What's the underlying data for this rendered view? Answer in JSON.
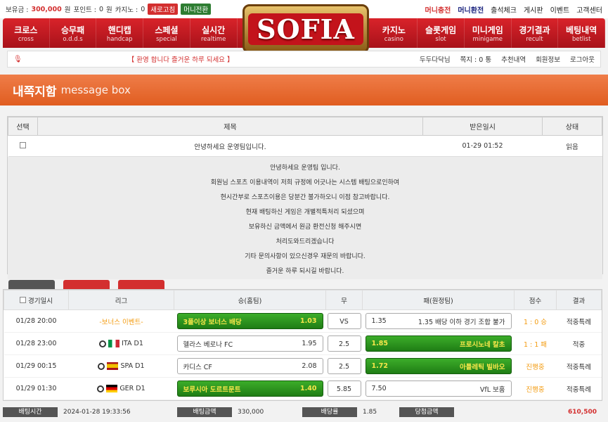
{
  "top": {
    "balance_label": "보유금 : ",
    "balance": "300,000",
    "won": "원",
    "point_label": "포인트 : ",
    "point": "0",
    "point_unit": "원",
    "casino_label": "카지노 : ",
    "casino": "0",
    "refresh": "새로고침",
    "money_convert": "머니전환",
    "links": [
      "머니충전",
      "머니환전",
      "출석체크",
      "게시판",
      "이벤트",
      "고객센터"
    ]
  },
  "nav": {
    "left": [
      {
        "ko": "크로스",
        "en": "cross"
      },
      {
        "ko": "승무패",
        "en": "o.d.d.s"
      },
      {
        "ko": "핸디캡",
        "en": "handcap"
      },
      {
        "ko": "스페셜",
        "en": "special"
      },
      {
        "ko": "실시간",
        "en": "realtime"
      }
    ],
    "right": [
      {
        "ko": "카지노",
        "en": "casino"
      },
      {
        "ko": "슬롯게임",
        "en": "slot"
      },
      {
        "ko": "미니게임",
        "en": "minigame"
      },
      {
        "ko": "경기결과",
        "en": "recult"
      },
      {
        "ko": "베팅내역",
        "en": "betlist"
      }
    ]
  },
  "logo": "SOFIA",
  "bar": {
    "welcome": "【 환영 합니다 즐거운 하루 되세요 】",
    "user": "두두다닥님",
    "notes": "쪽지 : 0 통",
    "recommend": "추천내역",
    "member": "회원정보",
    "logout": "로그아웃"
  },
  "page": {
    "title": "내쪽지함",
    "subtitle": "message box"
  },
  "msg_table": {
    "cols": [
      "선택",
      "제목",
      "받은일시",
      "상태"
    ],
    "row": {
      "title": "안녕하세요 운영팀입니다.",
      "date": "01-29 01:52",
      "status": "읽음"
    }
  },
  "message_lines": [
    "안녕하세요 운영팀 입니다.",
    "회원님 스포츠 이용내역이 저희 규정에 어긋나는 시스템 배팅으로인하여",
    "현시간부로 스포츠이용은 당분간 불가하오니 이점 참고바랍니다.",
    "현재 배팅하신 게임은 개별적특처리 되셨으며",
    "보유하신 금액에서 원금 환전신청 해주시면",
    "처리도와드리겠습니다",
    "기타 문의사항이 있으신경우 재문의 바랍니다.",
    "즐거운 하루 되시길 바랍니다."
  ],
  "bet_table": {
    "cols": [
      "경기일시",
      "리그",
      "승(홈팀)",
      "무",
      "패(원정팀)",
      "점수",
      "결과"
    ],
    "rows": [
      {
        "date": "01/28 20:00",
        "league": "-보너스 이벤트-",
        "home": "3폴이상 보너스 배당",
        "home_odds": "1.03",
        "draw": "VS",
        "away_odds": "1.35",
        "away": "1.35 배당 이하 경기 조합 불가",
        "score": "1 : 0 승",
        "result": "적중특례",
        "flag": "",
        "hl": "home"
      },
      {
        "date": "01/28 23:00",
        "league": "ITA D1",
        "home": "헬라스 베로나 FC",
        "home_odds": "1.95",
        "draw": "2.5",
        "away_odds": "1.85",
        "away": "프로시노네 칼초",
        "score": "1 : 1 패",
        "result": "적중",
        "flag": "it",
        "hl": "away"
      },
      {
        "date": "01/29 00:15",
        "league": "SPA D1",
        "home": "카디스 CF",
        "home_odds": "2.08",
        "draw": "2.5",
        "away_odds": "1.72",
        "away": "아틀레틱 빌바오",
        "score": "진행중",
        "result": "적중특례",
        "flag": "es",
        "hl": "away"
      },
      {
        "date": "01/29 01:30",
        "league": "GER D1",
        "home": "보루시아 도르트문트",
        "home_odds": "1.40",
        "draw": "5.85",
        "away_odds": "7.50",
        "away": "VfL 보훔",
        "score": "진행중",
        "result": "적중특례",
        "flag": "de",
        "hl": "home"
      }
    ]
  },
  "summary": {
    "time_label": "배팅시간",
    "time": "2024-01-28 19:33:56",
    "amount_label": "배팅금액",
    "amount": "330,000",
    "odds_label": "배당률",
    "odds": "1.85",
    "win_label": "당첨금액",
    "win": "610,500"
  }
}
